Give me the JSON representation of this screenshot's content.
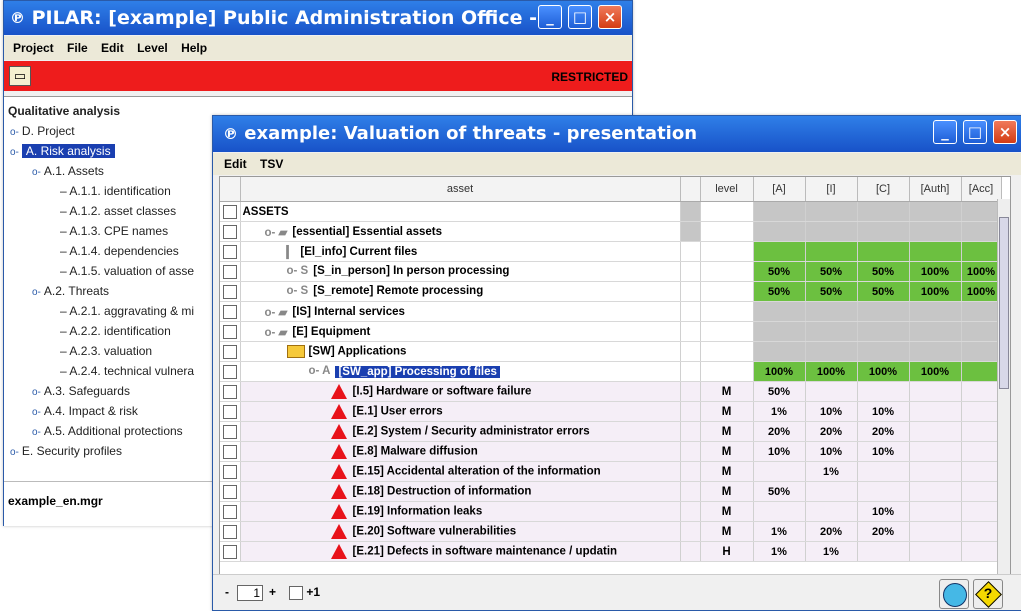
{
  "main": {
    "title": "PILAR: [example] Public Administration Office -...",
    "logo": "P",
    "menu": [
      "Project",
      "File",
      "Edit",
      "Level",
      "Help"
    ],
    "restricted": "RESTRICTED",
    "tree": [
      {
        "label": "Qualitative analysis"
      },
      {
        "label": "D. Project"
      },
      {
        "label": "A. Risk analysis"
      },
      {
        "label": "A.1. Assets"
      },
      {
        "label": "A.1.1. identification"
      },
      {
        "label": "A.1.2. asset classes"
      },
      {
        "label": "A.1.3. CPE names"
      },
      {
        "label": "A.1.4. dependencies"
      },
      {
        "label": "A.1.5. valuation of asse"
      },
      {
        "label": "A.2. Threats"
      },
      {
        "label": "A.2.1. aggravating & mi"
      },
      {
        "label": "A.2.2. identification"
      },
      {
        "label": "A.2.3. valuation"
      },
      {
        "label": "A.2.4. technical vulnera"
      },
      {
        "label": "A.3. Safeguards"
      },
      {
        "label": "A.4. Impact & risk"
      },
      {
        "label": "A.5. Additional protections"
      },
      {
        "label": "E. Security profiles"
      }
    ],
    "status": "example_en.mgr"
  },
  "val": {
    "title": "example: Valuation of threats - presentation",
    "logo": "P",
    "menu": [
      "Edit",
      "TSV"
    ],
    "columns": [
      "asset",
      "level",
      "[A]",
      "[I]",
      "[C]",
      "[Auth]",
      "[Acc]"
    ],
    "rows": [
      {
        "label": "ASSETS",
        "level": "",
        "vals": [
          "",
          "",
          "",
          "",
          ""
        ]
      },
      {
        "label": "[essential] Essential assets",
        "level": "",
        "vals": [
          "",
          "",
          "",
          "",
          ""
        ]
      },
      {
        "label": "[El_info] Current files",
        "level": "",
        "vals": [
          "",
          "",
          "",
          "",
          ""
        ]
      },
      {
        "label": "[S_in_person] In person processing",
        "level": "",
        "vals": [
          "50%",
          "50%",
          "50%",
          "100%",
          "100%"
        ]
      },
      {
        "label": "[S_remote] Remote processing",
        "level": "",
        "vals": [
          "50%",
          "50%",
          "50%",
          "100%",
          "100%"
        ]
      },
      {
        "label": "[IS] Internal services",
        "level": "",
        "vals": [
          "",
          "",
          "",
          "",
          ""
        ]
      },
      {
        "label": "[E] Equipment",
        "level": "",
        "vals": [
          "",
          "",
          "",
          "",
          ""
        ]
      },
      {
        "label": "[SW] Applications",
        "level": "",
        "vals": [
          "",
          "",
          "",
          "",
          ""
        ]
      },
      {
        "label": "[SW_app] Processing of files",
        "level": "",
        "vals": [
          "100%",
          "100%",
          "100%",
          "100%",
          ""
        ]
      },
      {
        "label": "[I.5] Hardware or software failure",
        "level": "M",
        "vals": [
          "50%",
          "",
          "",
          "",
          ""
        ]
      },
      {
        "label": "[E.1] User errors",
        "level": "M",
        "vals": [
          "1%",
          "10%",
          "10%",
          "",
          ""
        ]
      },
      {
        "label": "[E.2] System / Security administrator errors",
        "level": "M",
        "vals": [
          "20%",
          "20%",
          "20%",
          "",
          ""
        ]
      },
      {
        "label": "[E.8] Malware diffusion",
        "level": "M",
        "vals": [
          "10%",
          "10%",
          "10%",
          "",
          ""
        ]
      },
      {
        "label": "[E.15] Accidental alteration of the information",
        "level": "M",
        "vals": [
          "",
          "1%",
          "",
          "",
          ""
        ]
      },
      {
        "label": "[E.18] Destruction of information",
        "level": "M",
        "vals": [
          "50%",
          "",
          "",
          "",
          ""
        ]
      },
      {
        "label": "[E.19] Information leaks",
        "level": "M",
        "vals": [
          "",
          "",
          "10%",
          "",
          ""
        ]
      },
      {
        "label": "[E.20] Software vulnerabilities",
        "level": "M",
        "vals": [
          "1%",
          "20%",
          "20%",
          "",
          ""
        ]
      },
      {
        "label": "[E.21] Defects in software maintenance / updatin",
        "level": "H",
        "vals": [
          "1%",
          "1%",
          "",
          "",
          ""
        ]
      }
    ],
    "page": "1",
    "plus_label": "+",
    "minus_label": "-",
    "plus_one": "+1",
    "help_icon": "?"
  }
}
